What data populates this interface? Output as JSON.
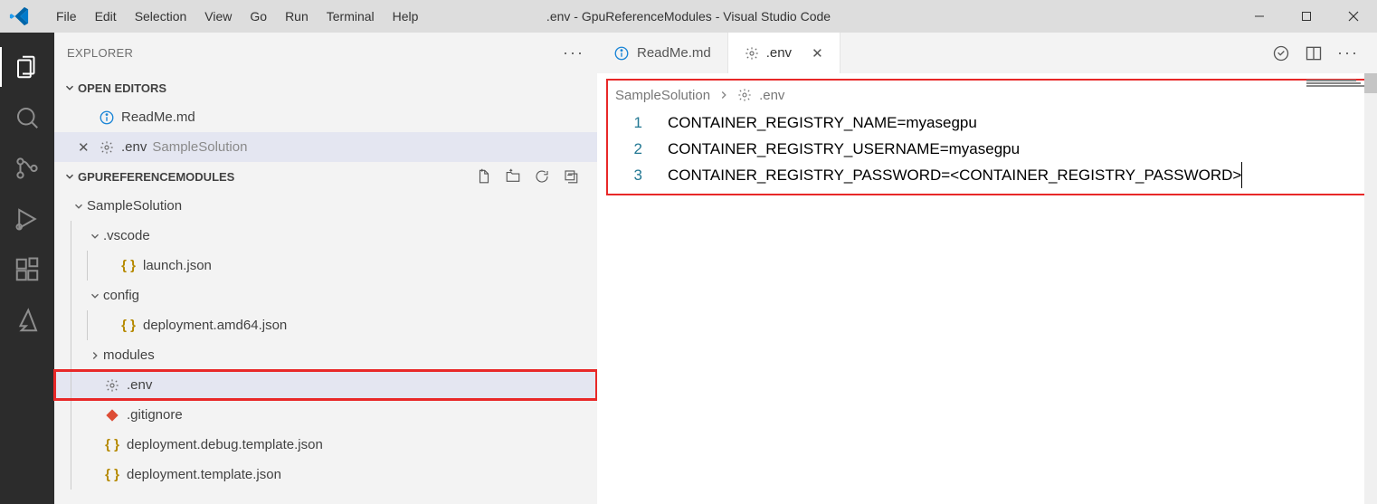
{
  "window": {
    "title": ".env - GpuReferenceModules - Visual Studio Code"
  },
  "menubar": {
    "items": [
      "File",
      "Edit",
      "Selection",
      "View",
      "Go",
      "Run",
      "Terminal",
      "Help"
    ]
  },
  "sidebar": {
    "header": "EXPLORER",
    "open_editors_label": "OPEN EDITORS",
    "open_editors": [
      {
        "icon": "info",
        "name": "ReadMe.md"
      },
      {
        "icon": "gear",
        "name": ".env",
        "detail": "SampleSolution",
        "active": true
      }
    ],
    "workspace_label": "GPUREFERENCEMODULES",
    "tree": [
      {
        "depth": 0,
        "type": "folder",
        "open": true,
        "name": "SampleSolution"
      },
      {
        "depth": 1,
        "type": "folder",
        "open": true,
        "name": ".vscode"
      },
      {
        "depth": 2,
        "type": "json",
        "name": "launch.json"
      },
      {
        "depth": 1,
        "type": "folder",
        "open": true,
        "name": "config"
      },
      {
        "depth": 2,
        "type": "json",
        "name": "deployment.amd64.json"
      },
      {
        "depth": 1,
        "type": "folder",
        "open": false,
        "name": "modules"
      },
      {
        "depth": 1,
        "type": "gear",
        "name": ".env",
        "selected": true,
        "highlighted": true
      },
      {
        "depth": 1,
        "type": "git",
        "name": ".gitignore"
      },
      {
        "depth": 1,
        "type": "json",
        "name": "deployment.debug.template.json"
      },
      {
        "depth": 1,
        "type": "json",
        "name": "deployment.template.json"
      }
    ]
  },
  "editor": {
    "tabs": [
      {
        "icon": "info",
        "label": "ReadMe.md",
        "active": false,
        "closeable": false
      },
      {
        "icon": "gear",
        "label": ".env",
        "active": true,
        "closeable": true
      }
    ],
    "breadcrumb": {
      "folder": "SampleSolution",
      "file": ".env"
    },
    "lines": [
      "CONTAINER_REGISTRY_NAME=myasegpu",
      "CONTAINER_REGISTRY_USERNAME=myasegpu",
      "CONTAINER_REGISTRY_PASSWORD=<CONTAINER_REGISTRY_PASSWORD>"
    ]
  }
}
